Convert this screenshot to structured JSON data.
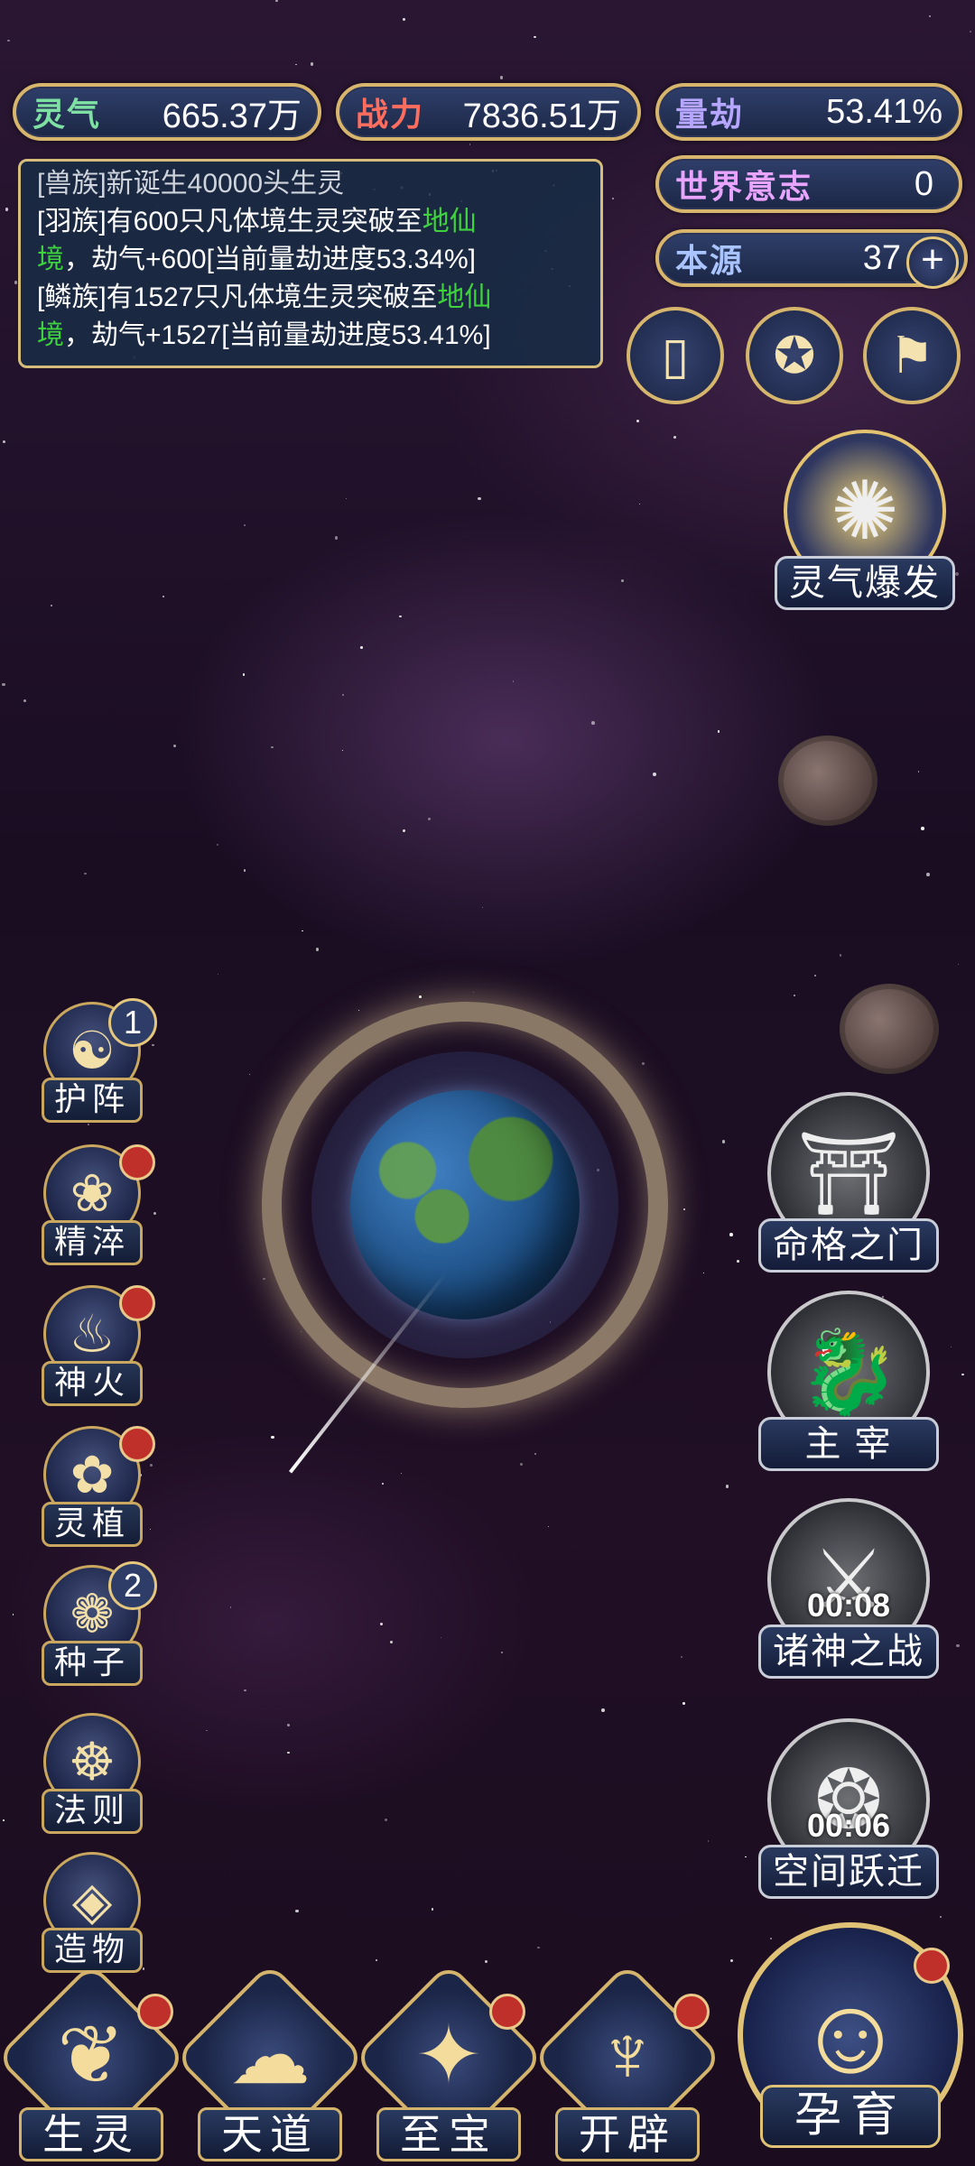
{
  "resources": {
    "lingqi": {
      "label": "灵气",
      "value": "665.37万"
    },
    "zhanli": {
      "label": "战力",
      "value": "7836.51万"
    },
    "liangjie": {
      "label": "量劫",
      "value": "53.41%"
    },
    "shijie": {
      "label": "世界意志",
      "value": "0"
    },
    "benyuan": {
      "label": "本源",
      "value": "37"
    }
  },
  "log": {
    "line0": "[兽族]新诞生40000头生灵",
    "line1_a": "[羽族]有600只凡体境生灵突破至",
    "line1_hl1": "地仙",
    "line1_hl2": "境",
    "line1_b": "，劫气+600[当前量劫进度53.34%]",
    "line2_a": "[鳞族]有1527只凡体境生灵突破至",
    "line2_hl1": "地仙",
    "line2_hl2": "境",
    "line2_b": "，劫气+1527[当前量劫进度53.41%]"
  },
  "left_buttons": [
    {
      "label": "护阵",
      "badge": "1"
    },
    {
      "label": "精淬"
    },
    {
      "label": "神火"
    },
    {
      "label": "灵植"
    },
    {
      "label": "种子",
      "badge": "2"
    },
    {
      "label": "法则"
    },
    {
      "label": "造物"
    }
  ],
  "right_buttons": {
    "burst": "灵气爆发",
    "fate": "命格之门",
    "master": "主 宰",
    "war": "诸神之战",
    "war_timer": "00:08",
    "leap": "空间跃迁",
    "leap_timer": "00:06"
  },
  "bottom": [
    "生灵",
    "天道",
    "至宝",
    "开辟"
  ],
  "bottom_main": "孕育",
  "colors": {
    "highlight": "#3fd23f",
    "gold": "#d6b66d",
    "badge_red": "#c0302b"
  }
}
